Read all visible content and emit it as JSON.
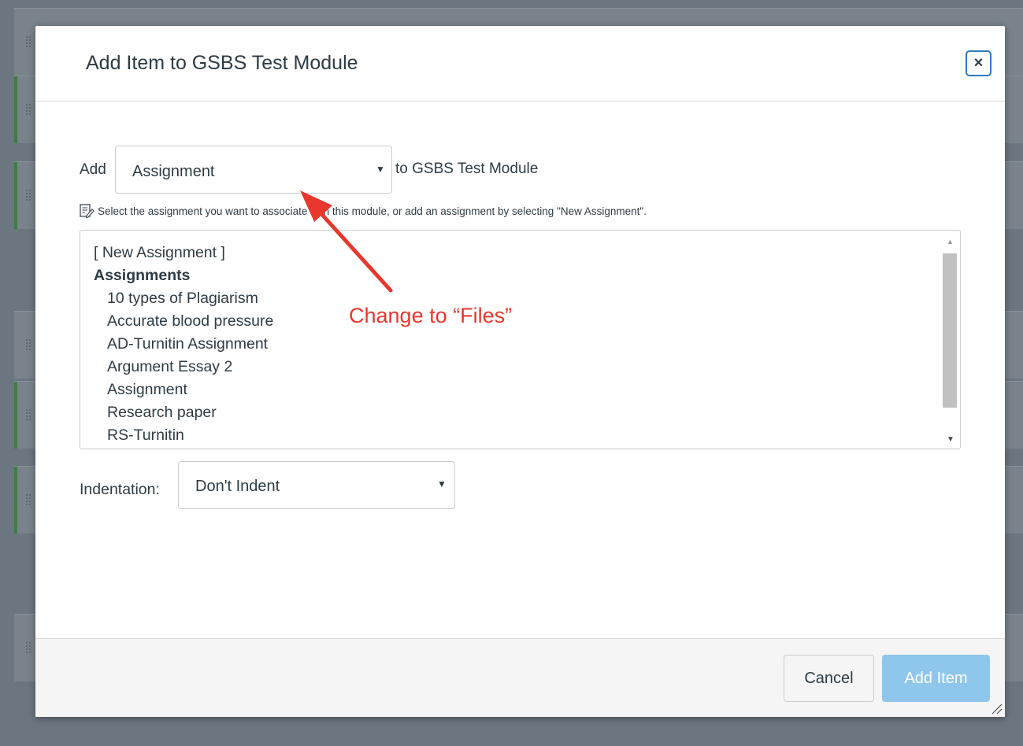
{
  "modal": {
    "title": "Add Item to GSBS Test Module",
    "close_label": "×"
  },
  "form": {
    "add_label": "Add",
    "item_type": "Assignment",
    "module_suffix": "to GSBS Test Module",
    "hint": "Select the assignment you want to associate with this module, or add an assignment by selecting \"New Assignment\".",
    "list": {
      "new_option": "[ New Assignment ]",
      "group_label": "Assignments",
      "items": [
        "10 types of Plagiarism",
        "Accurate blood pressure",
        "AD-Turnitin Assignment",
        "Argument Essay 2",
        "Assignment",
        "Research paper",
        "RS-Turnitin"
      ]
    },
    "indentation_label": "Indentation:",
    "indentation_value": "Don't Indent"
  },
  "annotation": {
    "text": "Change to “Files”",
    "color": "#e8382e"
  },
  "footer": {
    "cancel_label": "Cancel",
    "add_label": "Add Item"
  },
  "colors": {
    "primary_disabled": "#8fc6ec",
    "focus_ring": "#2b7abc",
    "text": "#2d3b45"
  }
}
